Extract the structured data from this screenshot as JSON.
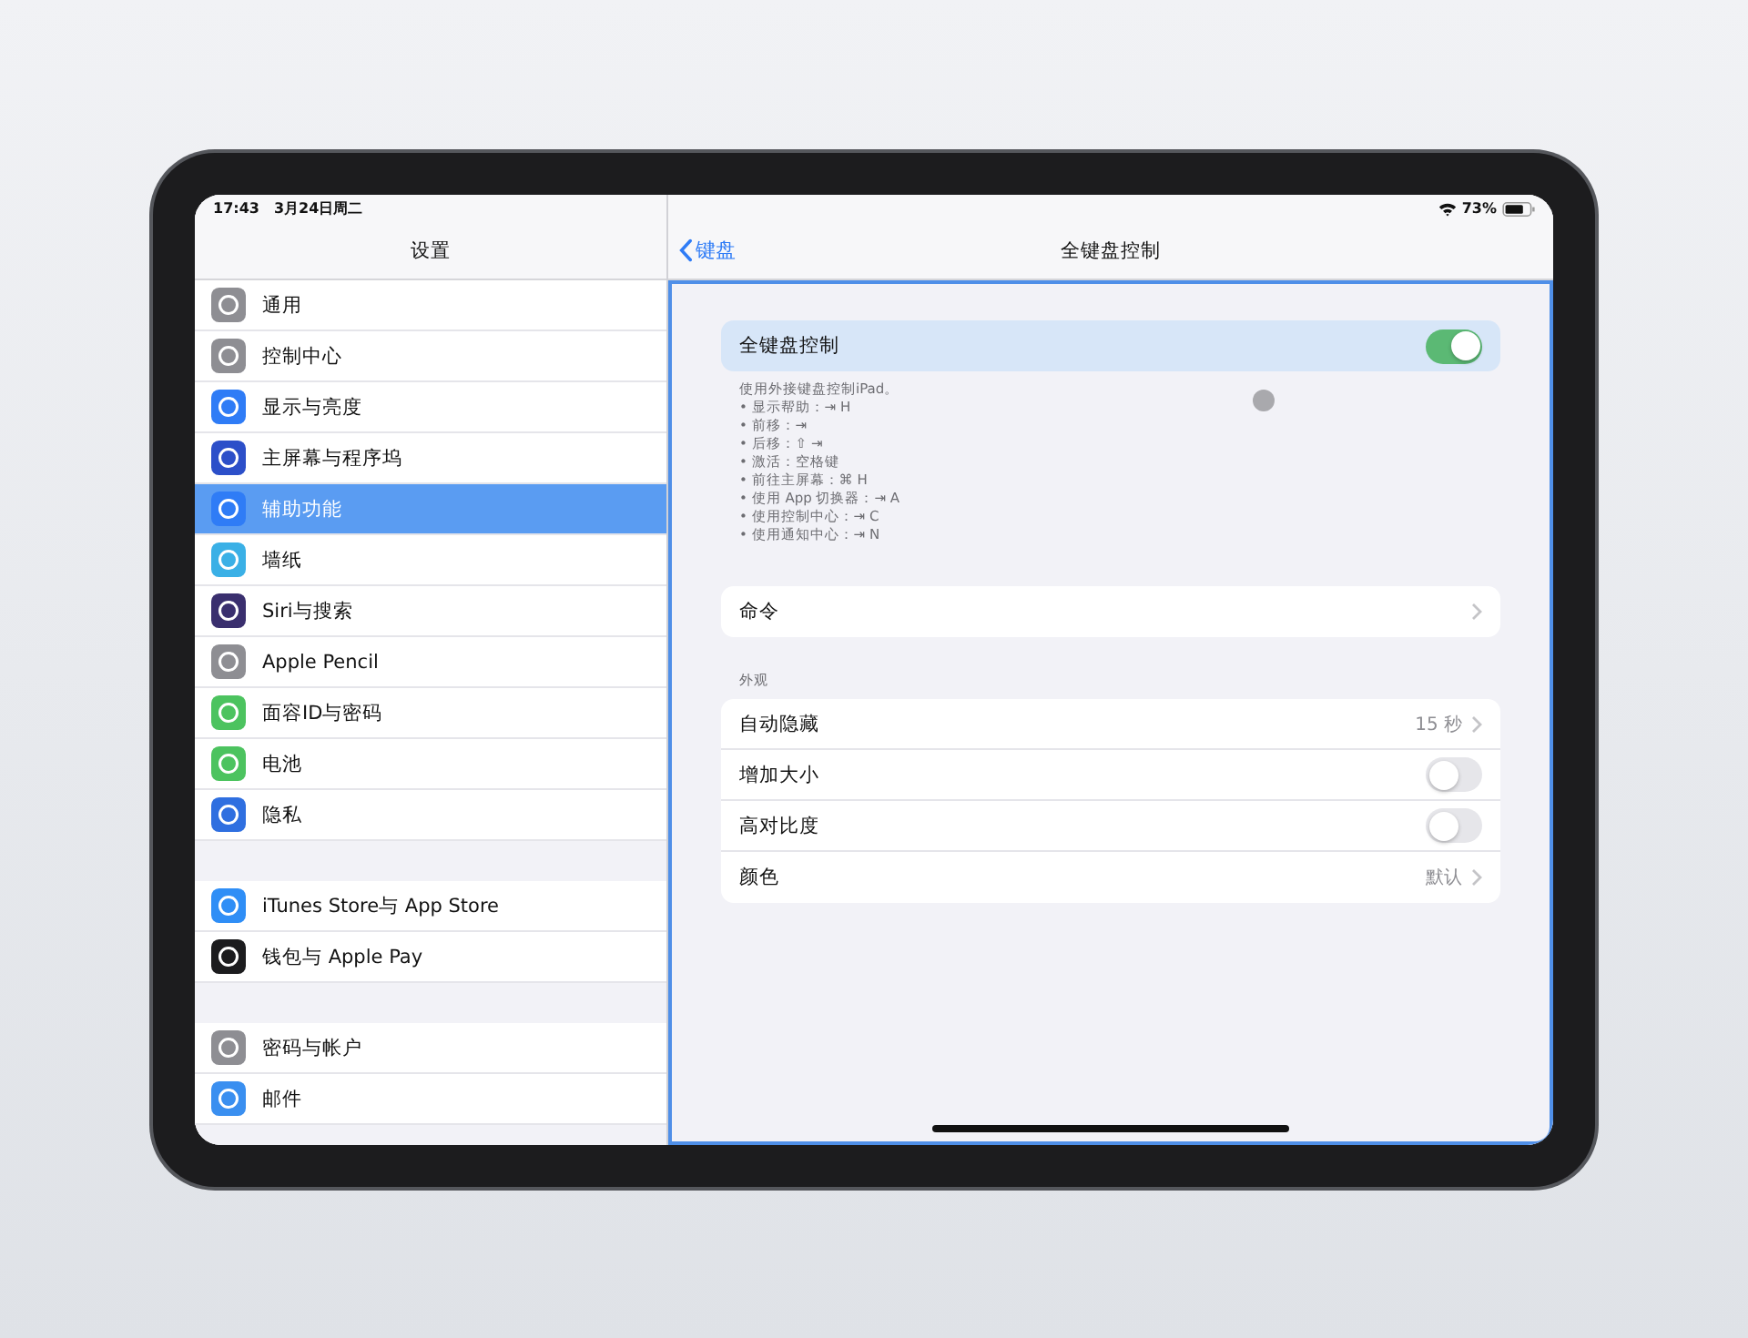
{
  "status_bar": {
    "time": "17:43",
    "date": "3月24日周二",
    "battery": "73%"
  },
  "sidebar": {
    "title": "设置",
    "groups": [
      {
        "items": [
          {
            "label": "通用",
            "color": "#8e8e93",
            "selected": false
          },
          {
            "label": "控制中心",
            "color": "#8e8e93",
            "selected": false
          },
          {
            "label": "显示与亮度",
            "color": "#2f7cf6",
            "selected": false
          },
          {
            "label": "主屏幕与程序坞",
            "color": "#2c4fc9",
            "selected": false
          },
          {
            "label": "辅助功能",
            "color": "#2f7cf6",
            "selected": true
          },
          {
            "label": "墙纸",
            "color": "#3ab0e6",
            "selected": false
          },
          {
            "label": "Siri与搜索",
            "color": "#3a2f6e",
            "selected": false
          },
          {
            "label": "Apple Pencil",
            "color": "#8e8e93",
            "selected": false
          },
          {
            "label": "面容ID与密码",
            "color": "#4cc35f",
            "selected": false
          },
          {
            "label": "电池",
            "color": "#4cc35f",
            "selected": false
          },
          {
            "label": "隐私",
            "color": "#2f6fe0",
            "selected": false
          }
        ]
      },
      {
        "items": [
          {
            "label": "iTunes Store与 App Store",
            "color": "#2f8ef6",
            "selected": false
          },
          {
            "label": "钱包与 Apple Pay",
            "color": "#1c1c1e",
            "selected": false
          }
        ]
      },
      {
        "items": [
          {
            "label": "密码与帐户",
            "color": "#8e8e93",
            "selected": false
          },
          {
            "label": "邮件",
            "color": "#3a8ff0",
            "selected": false
          }
        ]
      }
    ]
  },
  "detail": {
    "back": "键盘",
    "title": "全键盘控制",
    "main_toggle": {
      "label": "全键盘控制",
      "on": true
    },
    "description": [
      "使用外接键盘控制iPad。",
      "• 显示帮助：⇥ H",
      "• 前移：⇥",
      "• 后移：⇧ ⇥",
      "• 激活：空格键",
      "• 前往主屏幕：⌘ H",
      "• 使用 App 切换器：⇥ A",
      "• 使用控制中心：⇥ C",
      "• 使用通知中心：⇥ N"
    ],
    "commands": {
      "label": "命令"
    },
    "appearance": {
      "header": "外观",
      "rows": [
        {
          "kind": "value",
          "label": "自动隐藏",
          "value": "15 秒"
        },
        {
          "kind": "toggle",
          "label": "增加大小",
          "on": false
        },
        {
          "kind": "toggle",
          "label": "高对比度",
          "on": false
        },
        {
          "kind": "value",
          "label": "颜色",
          "value": "默认"
        }
      ]
    }
  }
}
